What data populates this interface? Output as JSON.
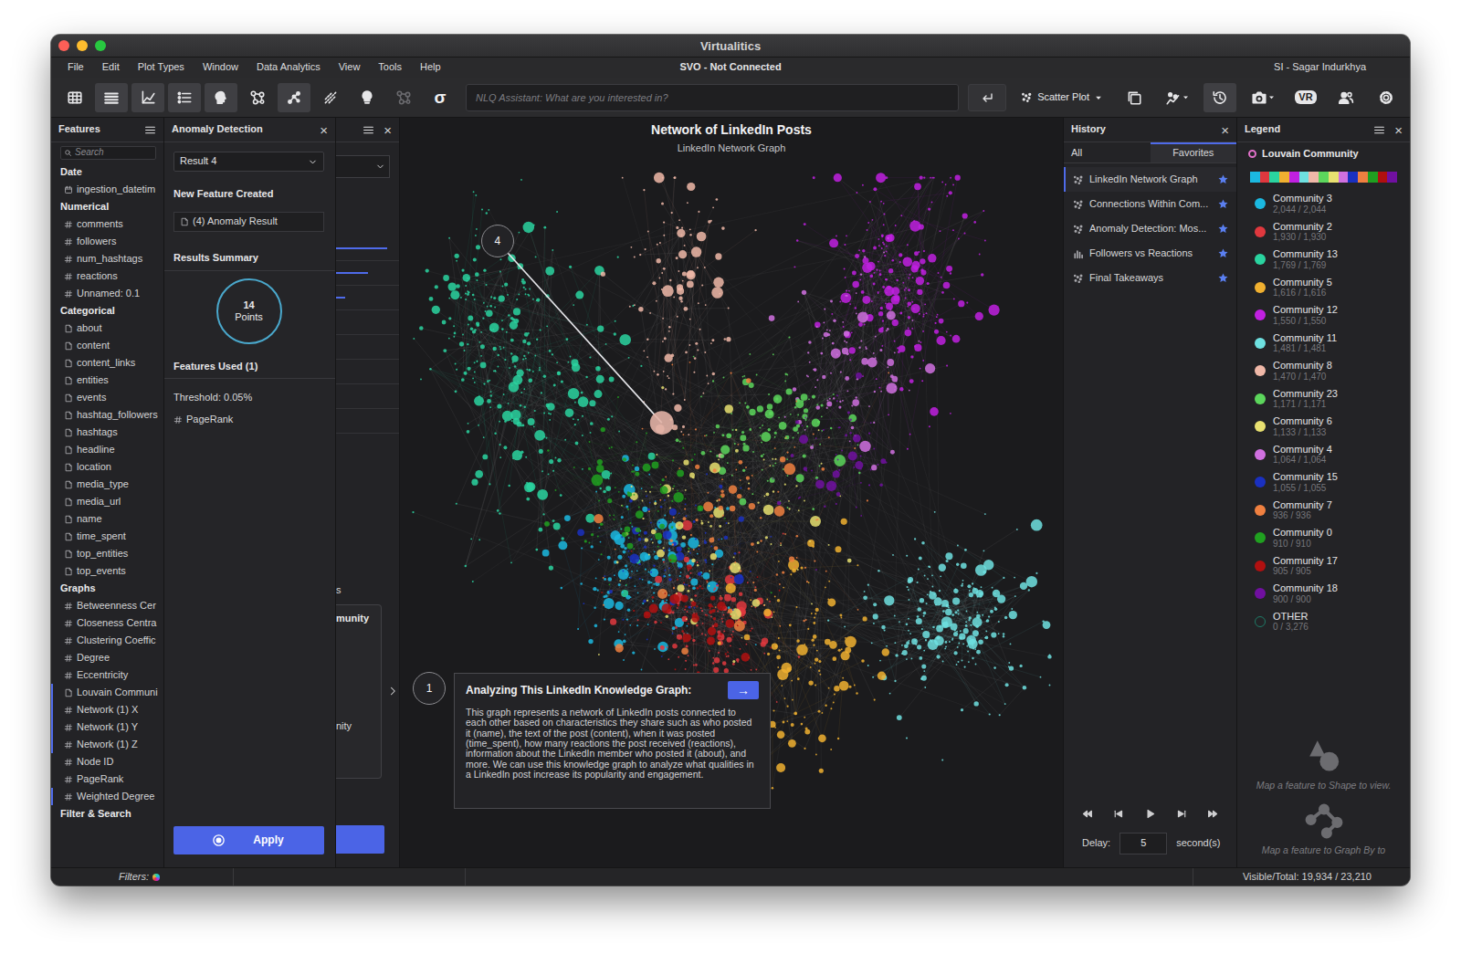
{
  "window": {
    "title": "Virtualitics"
  },
  "menu": {
    "items": [
      "File",
      "Edit",
      "Plot Types",
      "Window",
      "Data Analytics",
      "View",
      "Tools",
      "Help"
    ],
    "connection": "SVO - Not Connected",
    "user": "SI - Sagar Indurkhya"
  },
  "toolbar": {
    "left": [
      {
        "selected": false,
        "disabled": false
      },
      {
        "selected": true,
        "disabled": false
      },
      {
        "selected": true,
        "disabled": false
      },
      {
        "selected": true,
        "disabled": false
      },
      {
        "selected": true,
        "disabled": false
      },
      {
        "selected": false,
        "disabled": false
      },
      {
        "selected": true,
        "disabled": false
      },
      {
        "selected": false,
        "disabled": false
      },
      {
        "selected": false,
        "disabled": false
      },
      {
        "selected": false,
        "disabled": true
      },
      {
        "text": "σ",
        "selected": false,
        "disabled": false
      }
    ],
    "nlq": {
      "placeholder": "NLQ Assistant: What are you interested in?"
    },
    "plot_type": "Scatter Plot",
    "right": [
      {
        "selected": false,
        "dropdown": false
      },
      {
        "selected": false,
        "dropdown": true
      },
      {
        "selected": true,
        "dropdown": false
      },
      {
        "selected": false,
        "dropdown": true
      },
      {
        "text": "VR",
        "selected": false,
        "dropdown": false
      },
      {
        "selected": false,
        "dropdown": false
      },
      {
        "selected": false,
        "dropdown": false
      }
    ]
  },
  "features": {
    "title": "Features",
    "search": {
      "placeholder": "Search"
    },
    "sections": [
      {
        "title": "Date",
        "items": [
          {
            "label": "ingestion_datetim",
            "kind": "date",
            "mapped": false
          }
        ]
      },
      {
        "title": "Numerical",
        "items": [
          {
            "label": "comments",
            "kind": "number",
            "mapped": false
          },
          {
            "label": "followers",
            "kind": "number",
            "mapped": false
          },
          {
            "label": "num_hashtags",
            "kind": "number",
            "mapped": false
          },
          {
            "label": "reactions",
            "kind": "number",
            "mapped": false
          },
          {
            "label": "Unnamed: 0.1",
            "kind": "number",
            "mapped": false
          }
        ]
      },
      {
        "title": "Categorical",
        "items": [
          {
            "label": "about",
            "kind": "text",
            "mapped": false
          },
          {
            "label": "content",
            "kind": "text",
            "mapped": false
          },
          {
            "label": "content_links",
            "kind": "text",
            "mapped": false
          },
          {
            "label": "entities",
            "kind": "text",
            "mapped": false
          },
          {
            "label": "events",
            "kind": "text",
            "mapped": false
          },
          {
            "label": "hashtag_followers",
            "kind": "text",
            "mapped": false
          },
          {
            "label": "hashtags",
            "kind": "text",
            "mapped": false
          },
          {
            "label": "headline",
            "kind": "text",
            "mapped": false
          },
          {
            "label": "location",
            "kind": "text",
            "mapped": false
          },
          {
            "label": "media_type",
            "kind": "text",
            "mapped": false
          },
          {
            "label": "media_url",
            "kind": "text",
            "mapped": false
          },
          {
            "label": "name",
            "kind": "text",
            "mapped": false
          },
          {
            "label": "time_spent",
            "kind": "text",
            "mapped": false
          },
          {
            "label": "top_entities",
            "kind": "text",
            "mapped": false
          },
          {
            "label": "top_events",
            "kind": "text",
            "mapped": false
          }
        ]
      },
      {
        "title": "Graphs",
        "items": [
          {
            "label": "Betweenness Cer",
            "kind": "number",
            "mapped": false
          },
          {
            "label": "Closeness Centra",
            "kind": "number",
            "mapped": false
          },
          {
            "label": "Clustering Coeffic",
            "kind": "number",
            "mapped": false
          },
          {
            "label": "Degree",
            "kind": "number",
            "mapped": false
          },
          {
            "label": "Eccentricity",
            "kind": "number",
            "mapped": false
          },
          {
            "label": "Louvain Communi",
            "kind": "text",
            "mapped": true
          },
          {
            "label": "Network (1) X",
            "kind": "number",
            "mapped": true
          },
          {
            "label": "Network (1) Y",
            "kind": "number",
            "mapped": true
          },
          {
            "label": "Network (1) Z",
            "kind": "number",
            "mapped": true
          },
          {
            "label": "Node ID",
            "kind": "number",
            "mapped": false
          },
          {
            "label": "PageRank",
            "kind": "number",
            "mapped": false
          },
          {
            "label": "Weighted Degree",
            "kind": "number",
            "mapped": true
          }
        ]
      },
      {
        "title": "Filter & Search",
        "items": []
      }
    ]
  },
  "anomaly": {
    "title": "Anomaly Detection",
    "close": "×",
    "result": "Result 4",
    "new_feature_title": "New Feature Created",
    "new_feature": "(4) Anomaly Result",
    "summary_title": "Results Summary",
    "points_count": "14",
    "points_label": "Points",
    "features_used_title": "Features Used (1)",
    "threshold": "Threshold: 0.05%",
    "features_used": [
      "PageRank"
    ],
    "apply": "Apply"
  },
  "behind_panel": {
    "close": "×",
    "bars": [
      {
        "level": 1
      },
      {
        "level": 0.62
      },
      {
        "level": 0.18
      },
      {
        "level": 0
      },
      {
        "level": 0
      },
      {
        "level": 0
      },
      {
        "level": 0
      },
      {
        "level": 0
      }
    ],
    "fragments": [
      "s",
      "munity",
      "nity"
    ]
  },
  "graph": {
    "title": "Network of LinkedIn Posts",
    "subtitle": "LinkedIn Network Graph",
    "clusters": [
      {
        "color": "#2ad4a0",
        "x": 21,
        "y": 37,
        "sx": 7,
        "sy": 10,
        "points": 220
      },
      {
        "color": "#2ad4a0",
        "x": 12,
        "y": 26,
        "sx": 4,
        "sy": 6,
        "points": 110
      },
      {
        "color": "#c020e0",
        "x": 76,
        "y": 22,
        "sx": 6,
        "sy": 8,
        "points": 220
      },
      {
        "color": "#d070e0",
        "x": 68,
        "y": 32,
        "sx": 5,
        "sy": 6,
        "points": 100
      },
      {
        "color": "#6ee0e0",
        "x": 82,
        "y": 68,
        "sx": 7,
        "sy": 5,
        "points": 240
      },
      {
        "color": "#1bb8e0",
        "x": 37,
        "y": 62,
        "sx": 6,
        "sy": 6,
        "points": 150
      },
      {
        "color": "#e0383e",
        "x": 47,
        "y": 68,
        "sx": 5,
        "sy": 5,
        "points": 140
      },
      {
        "color": "#f0b030",
        "x": 60,
        "y": 73,
        "sx": 5,
        "sy": 7,
        "points": 130
      },
      {
        "color": "#f0b8a8",
        "x": 42,
        "y": 24,
        "sx": 4,
        "sy": 10,
        "points": 120
      },
      {
        "color": "#5cd65c",
        "x": 56,
        "y": 42,
        "sx": 6,
        "sy": 5,
        "points": 120
      },
      {
        "color": "#e8e070",
        "x": 48,
        "y": 54,
        "sx": 9,
        "sy": 8,
        "points": 100
      },
      {
        "color": "#1a30c0",
        "x": 42,
        "y": 58,
        "sx": 6,
        "sy": 5,
        "points": 90
      },
      {
        "color": "#f08040",
        "x": 52,
        "y": 55,
        "sx": 9,
        "sy": 9,
        "points": 110
      },
      {
        "color": "#20a020",
        "x": 36,
        "y": 49,
        "sx": 6,
        "sy": 6,
        "points": 80
      },
      {
        "color": "#b01010",
        "x": 45,
        "y": 66,
        "sx": 5,
        "sy": 4,
        "points": 70
      },
      {
        "color": "#7010a0",
        "x": 66,
        "y": 46,
        "sx": 5,
        "sy": 5,
        "points": 60
      }
    ],
    "callouts": [
      {
        "number": "4",
        "x": 14.7,
        "y": 16.5,
        "target_x": 39.5,
        "target_y": 40.7
      }
    ],
    "caption": {
      "number": "1",
      "title": "Analyzing This LinkedIn Knowledge Graph:",
      "arrow": "→",
      "body": "This graph represents a network of LinkedIn posts connected to each other based on characteristics they share such as who posted it (name), the text of the post (content), when it was posted (time_spent), how many reactions the post received (reactions), information about the LinkedIn member who posted it (about), and more. We can use this knowledge graph to analyze what qualities in a LinkedIn post increase its popularity and engagement."
    }
  },
  "history": {
    "title": "History",
    "close": "×",
    "tabs": [
      {
        "label": "All",
        "selected": false
      },
      {
        "label": "Favorites",
        "selected": true
      }
    ],
    "items": [
      {
        "label": "LinkedIn Network Graph",
        "kind": "scatter",
        "selected": true,
        "favorite": true
      },
      {
        "label": "Connections Within Com...",
        "kind": "scatter",
        "selected": false,
        "favorite": true
      },
      {
        "label": "Anomaly Detection: Mos...",
        "kind": "scatter",
        "selected": false,
        "favorite": true
      },
      {
        "label": "Followers vs Reactions",
        "kind": "bar",
        "selected": false,
        "favorite": true
      },
      {
        "label": "Final Takeaways",
        "kind": "scatter",
        "selected": false,
        "favorite": true
      }
    ],
    "delay_label": "Delay:",
    "delay": "5",
    "delay_unit": "second(s)"
  },
  "legend": {
    "title": "Legend",
    "close": "×",
    "feature": "Louvain Community",
    "communities": [
      {
        "name": "Community 3",
        "count": "2,044 / 2,044",
        "color": "#1bb8e0",
        "hollow": false
      },
      {
        "name": "Community 2",
        "count": "1,930 / 1,930",
        "color": "#e0383e",
        "hollow": false
      },
      {
        "name": "Community 13",
        "count": "1,769 / 1,769",
        "color": "#2ad4a0",
        "hollow": false
      },
      {
        "name": "Community 5",
        "count": "1,616 / 1,616",
        "color": "#f0b030",
        "hollow": false
      },
      {
        "name": "Community 12",
        "count": "1,550 / 1,550",
        "color": "#c020e0",
        "hollow": false
      },
      {
        "name": "Community 11",
        "count": "1,481 / 1,481",
        "color": "#6ee0e0",
        "hollow": false
      },
      {
        "name": "Community 8",
        "count": "1,470 / 1,470",
        "color": "#f0b8a8",
        "hollow": false
      },
      {
        "name": "Community 23",
        "count": "1,171 / 1,171",
        "color": "#5cd65c",
        "hollow": false
      },
      {
        "name": "Community 6",
        "count": "1,133 / 1,133",
        "color": "#e8e070",
        "hollow": false
      },
      {
        "name": "Community 4",
        "count": "1,064 / 1,064",
        "color": "#d070e0",
        "hollow": false
      },
      {
        "name": "Community 15",
        "count": "1,055 / 1,055",
        "color": "#1a30c0",
        "hollow": false
      },
      {
        "name": "Community 7",
        "count": "936 / 936",
        "color": "#f08040",
        "hollow": false
      },
      {
        "name": "Community 0",
        "count": "910 / 910",
        "color": "#20a020",
        "hollow": false
      },
      {
        "name": "Community 17",
        "count": "905 / 905",
        "color": "#b01010",
        "hollow": false
      },
      {
        "name": "Community 18",
        "count": "900 / 900",
        "color": "#7010a0",
        "hollow": false
      },
      {
        "name": "OTHER",
        "count": "0 / 3,276",
        "color": "#1f7a66",
        "hollow": true
      }
    ],
    "shape_hint": "Map a feature to Shape to view.",
    "graph_hint": "Map a feature to Graph By to"
  },
  "status_bar": {
    "filters": "Filters:",
    "visible": "Visible/Total: 19,934 / 23,210"
  }
}
